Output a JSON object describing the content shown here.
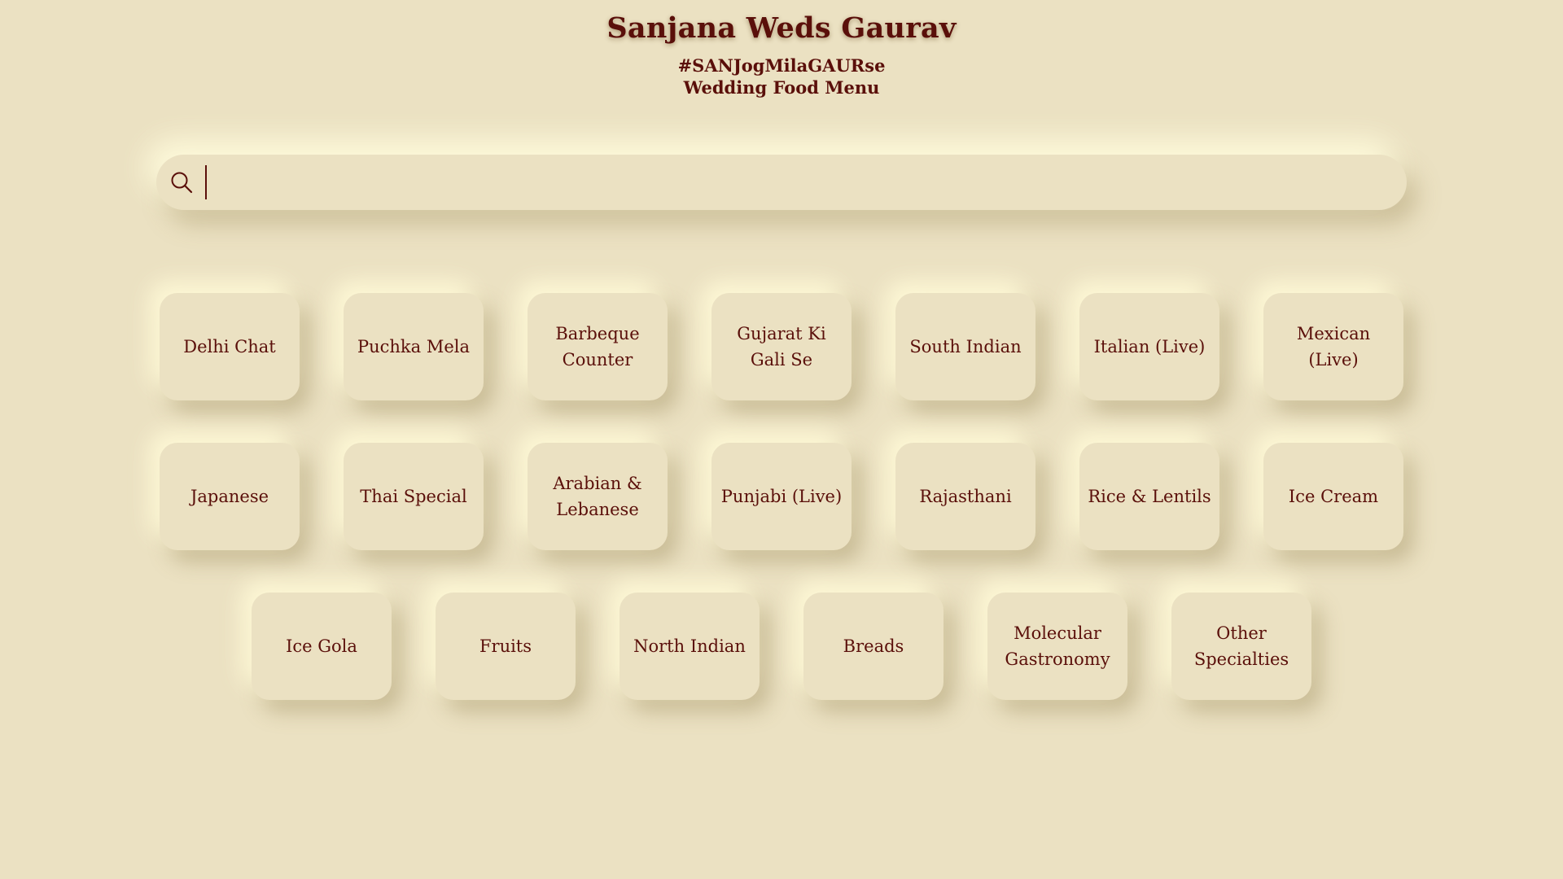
{
  "header": {
    "title": "Sanjana Weds Gaurav",
    "hashtag": "#SANJogMilaGAURse",
    "subtitle": "Wedding Food Menu"
  },
  "search": {
    "value": "",
    "placeholder": "",
    "icon": "search-icon"
  },
  "menu": {
    "row1": [
      {
        "label": "Delhi Chat"
      },
      {
        "label": "Puchka Mela"
      },
      {
        "label": "Barbeque Counter"
      },
      {
        "label": "Gujarat Ki Gali Se"
      },
      {
        "label": "South Indian"
      },
      {
        "label": "Italian (Live)"
      },
      {
        "label": "Mexican (Live)"
      }
    ],
    "row2": [
      {
        "label": "Japanese"
      },
      {
        "label": "Thai Special"
      },
      {
        "label": "Arabian & Lebanese"
      },
      {
        "label": "Punjabi (Live)"
      },
      {
        "label": "Rajasthani"
      },
      {
        "label": "Rice & Lentils"
      },
      {
        "label": "Ice Cream"
      }
    ],
    "row3": [
      {
        "label": "Ice Gola"
      },
      {
        "label": "Fruits"
      },
      {
        "label": "North Indian"
      },
      {
        "label": "Breads"
      },
      {
        "label": "Molecular Gastronomy"
      },
      {
        "label": "Other Specialties"
      }
    ]
  },
  "colors": {
    "background": "#ebe1c2",
    "text": "#5a0f0a"
  }
}
